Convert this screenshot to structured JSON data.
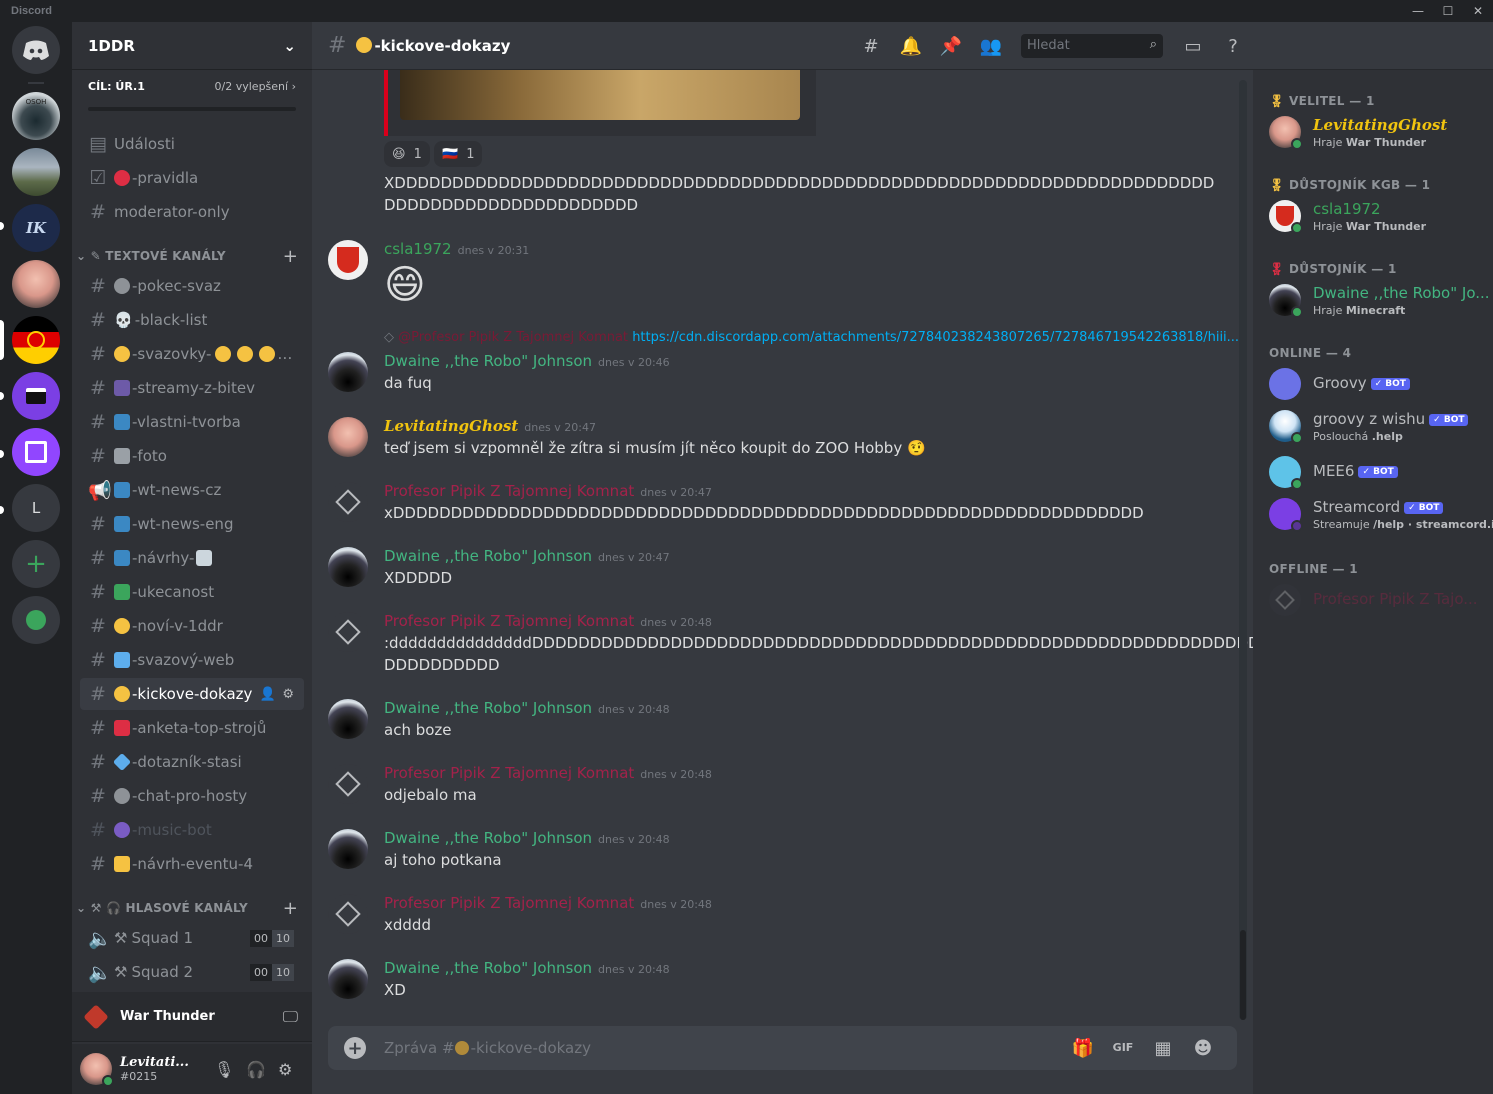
{
  "app": {
    "name": "Discord",
    "win_min": "—",
    "win_max": "☐",
    "win_close": "✕"
  },
  "servers": [
    {
      "label": "Discord home"
    },
    {
      "label": "OSOH"
    },
    {
      "label": "tank server"
    },
    {
      "label": "IK"
    },
    {
      "label": "baby avatar"
    },
    {
      "label": "DDR"
    },
    {
      "label": "clapper"
    },
    {
      "label": "twitch"
    },
    {
      "label": "L"
    },
    {
      "label": "+"
    },
    {
      "label": "explore"
    }
  ],
  "guild": {
    "name": "1DDR",
    "boost_goal": "CÍL: ÚR.1",
    "boost_count": "0/2 vylepšení",
    "events": "Události",
    "rules": "-pravidla",
    "moderator": "moderator-only",
    "text_category": "TEXTOVÉ KANÁLY",
    "voice_category": "HLASOVÉ KANÁLY",
    "channels": [
      "-pokec-svaz",
      "-black-list",
      "-svazovky-",
      "-streamy-z-bitev",
      "-vlastni-tvorba",
      "-foto",
      "-wt-news-cz",
      "-wt-news-eng",
      "-návrhy-",
      "-ukecanost",
      "-noví-v-1ddr",
      "-svazový-web",
      "-kickove-dokazy",
      "-anketa-top-strojů",
      "-dotazník-stasi",
      "-chat-pro-hosty",
      "-music-bot",
      "-návrh-eventu-4"
    ],
    "voice": [
      {
        "name": "Squad 1",
        "count": "00",
        "limit": "10"
      },
      {
        "name": "Squad 2",
        "count": "00",
        "limit": "10"
      }
    ]
  },
  "activity": {
    "game": "War Thunder"
  },
  "user": {
    "name": "Levitati...",
    "tag": "#0215"
  },
  "chat": {
    "channel": "-kickove-dokazy",
    "search_placeholder": "Hledat",
    "reactions": [
      {
        "emoji": "😆",
        "count": "1"
      },
      {
        "emoji": "🇷🇺",
        "count": "1"
      }
    ],
    "x_line1": "XDDDDDDDDDDDDDDDDDDDDDDDDDDDDDDDDDDDDDDDDDDDDDDDDDDDDDDDDDDDDDDDDDDDDDDD",
    "x_line2": "DDDDDDDDDDDDDDDDDDDDDD",
    "reply_author": "@Profesor Pipik Z Tajomnej Komnat",
    "reply_link": "https://cdn.discordapp.com/attachments/727840238243807265/727846719542263818/hiii...",
    "messages": [
      {
        "author": "csla1972",
        "time": "dnes v 20:31",
        "text": "😄"
      },
      {
        "author": "Dwaine ,,the Robo\" Johnson",
        "time": "dnes v 20:46",
        "text": "da fuq"
      },
      {
        "author": "LevitatingGhost",
        "time": "dnes v 20:47",
        "text": "teď jsem si vzpomněl že zítra si musím jít něco koupit do ZOO Hobby 🤨"
      },
      {
        "author": "Profesor Pipik Z Tajomnej Komnat",
        "time": "dnes v 20:47",
        "text": "xDDDDDDDDDDDDDDDDDDDDDDDDDDDDDDDDDDDDDDDDDDDDDDDDDDDDDDDDDDDDDDDDD"
      },
      {
        "author": "Dwaine ,,the Robo\" Johnson",
        "time": "dnes v 20:47",
        "text": "XDDDDD"
      },
      {
        "author": "Profesor Pipik Z Tajomnej Komnat",
        "time": "dnes v 20:48",
        "text": ":dddddddddddddddDDDDDDDDDDDDDDDDDDDDDDDDDDDDDDDDDDDDDDDDDDDDDDDDDDDDDDDDDDDDDDD",
        "text2": "DDDDDDDDDD"
      },
      {
        "author": "Dwaine ,,the Robo\" Johnson",
        "time": "dnes v 20:48",
        "text": "ach boze"
      },
      {
        "author": "Profesor Pipik Z Tajomnej Komnat",
        "time": "dnes v 20:48",
        "text": "odjebalo ma"
      },
      {
        "author": "Dwaine ,,the Robo\" Johnson",
        "time": "dnes v 20:48",
        "text": "aj toho potkana"
      },
      {
        "author": "Profesor Pipik Z Tajomnej Komnat",
        "time": "dnes v 20:48",
        "text": "xdddd"
      },
      {
        "author": "Dwaine ,,the Robo\" Johnson",
        "time": "dnes v 20:48",
        "text": "XD"
      }
    ],
    "composer_placeholder": "Zpráva #",
    "composer_channel": "-kickove-dokazy"
  },
  "members": {
    "groups": [
      {
        "title": "VELITEL — 1"
      },
      {
        "title": "DŮSTOJNÍK KGB — 1"
      },
      {
        "title": "DŮSTOJNÍK — 1"
      },
      {
        "title": "ONLINE — 4"
      },
      {
        "title": "OFFLINE — 1"
      }
    ],
    "list": [
      {
        "name": "LevitatingGhost",
        "status_prefix": "Hraje ",
        "status_bold": "War Thunder"
      },
      {
        "name": "csla1972",
        "status_prefix": "Hraje ",
        "status_bold": "War Thunder"
      },
      {
        "name": "Dwaine ,,the Robo\" Jo...",
        "status_prefix": "Hraje ",
        "status_bold": "Minecraft"
      },
      {
        "name": "Groovy",
        "badge": "✓ BOT"
      },
      {
        "name": "groovy z wishu",
        "badge": "✓ BOT",
        "status_prefix": "Poslouchá ",
        "status_bold": ".help"
      },
      {
        "name": "MEE6",
        "badge": "✓ BOT"
      },
      {
        "name": "Streamcord",
        "badge": "✓ BOT",
        "status_prefix": "Streamuje ",
        "status_bold": "/help · streamcord.io"
      },
      {
        "name": "Profesor Pipik Z Tajo..."
      }
    ]
  },
  "colors": {
    "accent": "#5865f2",
    "online": "#3ba55c",
    "red": "#ed4245"
  }
}
